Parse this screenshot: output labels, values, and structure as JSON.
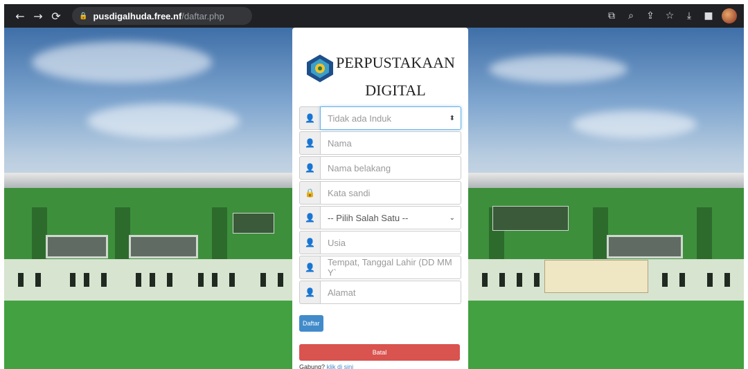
{
  "browser": {
    "url_host": "pusdigalhuda.free.nf",
    "url_path": "/daftar.php"
  },
  "brand": {
    "line1": "PERPUSTAKAAN",
    "line2": "DIGITAL"
  },
  "form": {
    "fields": [
      {
        "placeholder": "Tidak ada Induk",
        "icon": "user-icon"
      },
      {
        "placeholder": "Nama",
        "icon": "user-icon"
      },
      {
        "placeholder": "Nama belakang",
        "icon": "user-icon"
      },
      {
        "placeholder": "Kata sandi",
        "icon": "lock-icon"
      },
      {
        "value": "-- Pilih Salah Satu --",
        "icon": "user-icon"
      },
      {
        "placeholder": "Usia",
        "icon": "user-icon"
      },
      {
        "placeholder": "Tempat, Tanggal Lahir (DD MM Y`",
        "icon": "user-icon"
      },
      {
        "placeholder": "Alamat",
        "icon": "user-icon"
      }
    ],
    "submit_label": "Daftar",
    "cancel_label": "Batal",
    "login_prompt": "Gabung?",
    "login_link": "klik di sini"
  },
  "colors": {
    "primary": "#428bca",
    "danger": "#d9534f",
    "browser_chrome": "#202124"
  }
}
